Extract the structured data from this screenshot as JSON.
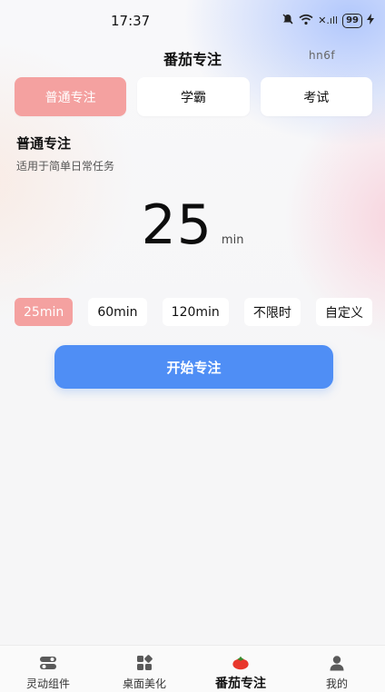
{
  "status_bar": {
    "time": "17:37",
    "battery": "99",
    "signal": "✕.ıll"
  },
  "header": {
    "title": "番茄专注",
    "code": "hn6f"
  },
  "modes": [
    {
      "label": "普通专注",
      "active": true
    },
    {
      "label": "学霸",
      "active": false
    },
    {
      "label": "考试",
      "active": false
    }
  ],
  "section": {
    "title": "普通专注",
    "description": "适用于简单日常任务"
  },
  "timer": {
    "value": "25",
    "unit": "min"
  },
  "durations": [
    {
      "label": "25min",
      "active": true
    },
    {
      "label": "60min",
      "active": false
    },
    {
      "label": "120min",
      "active": false
    },
    {
      "label": "不限时",
      "active": false
    },
    {
      "label": "自定义",
      "active": false
    }
  ],
  "start_button": {
    "label": "开始专注"
  },
  "nav": {
    "items": [
      {
        "label": "灵动组件",
        "icon": "toggle-icon",
        "active": false
      },
      {
        "label": "桌面美化",
        "icon": "grid-icon",
        "active": false
      },
      {
        "label": "番茄专注",
        "icon": "tomato-icon",
        "active": true
      },
      {
        "label": "我的",
        "icon": "person-icon",
        "active": false
      }
    ]
  },
  "colors": {
    "accent_pink": "#f4a1a0",
    "primary_blue": "#4f8ef5",
    "tomato_red": "#e8372c"
  }
}
